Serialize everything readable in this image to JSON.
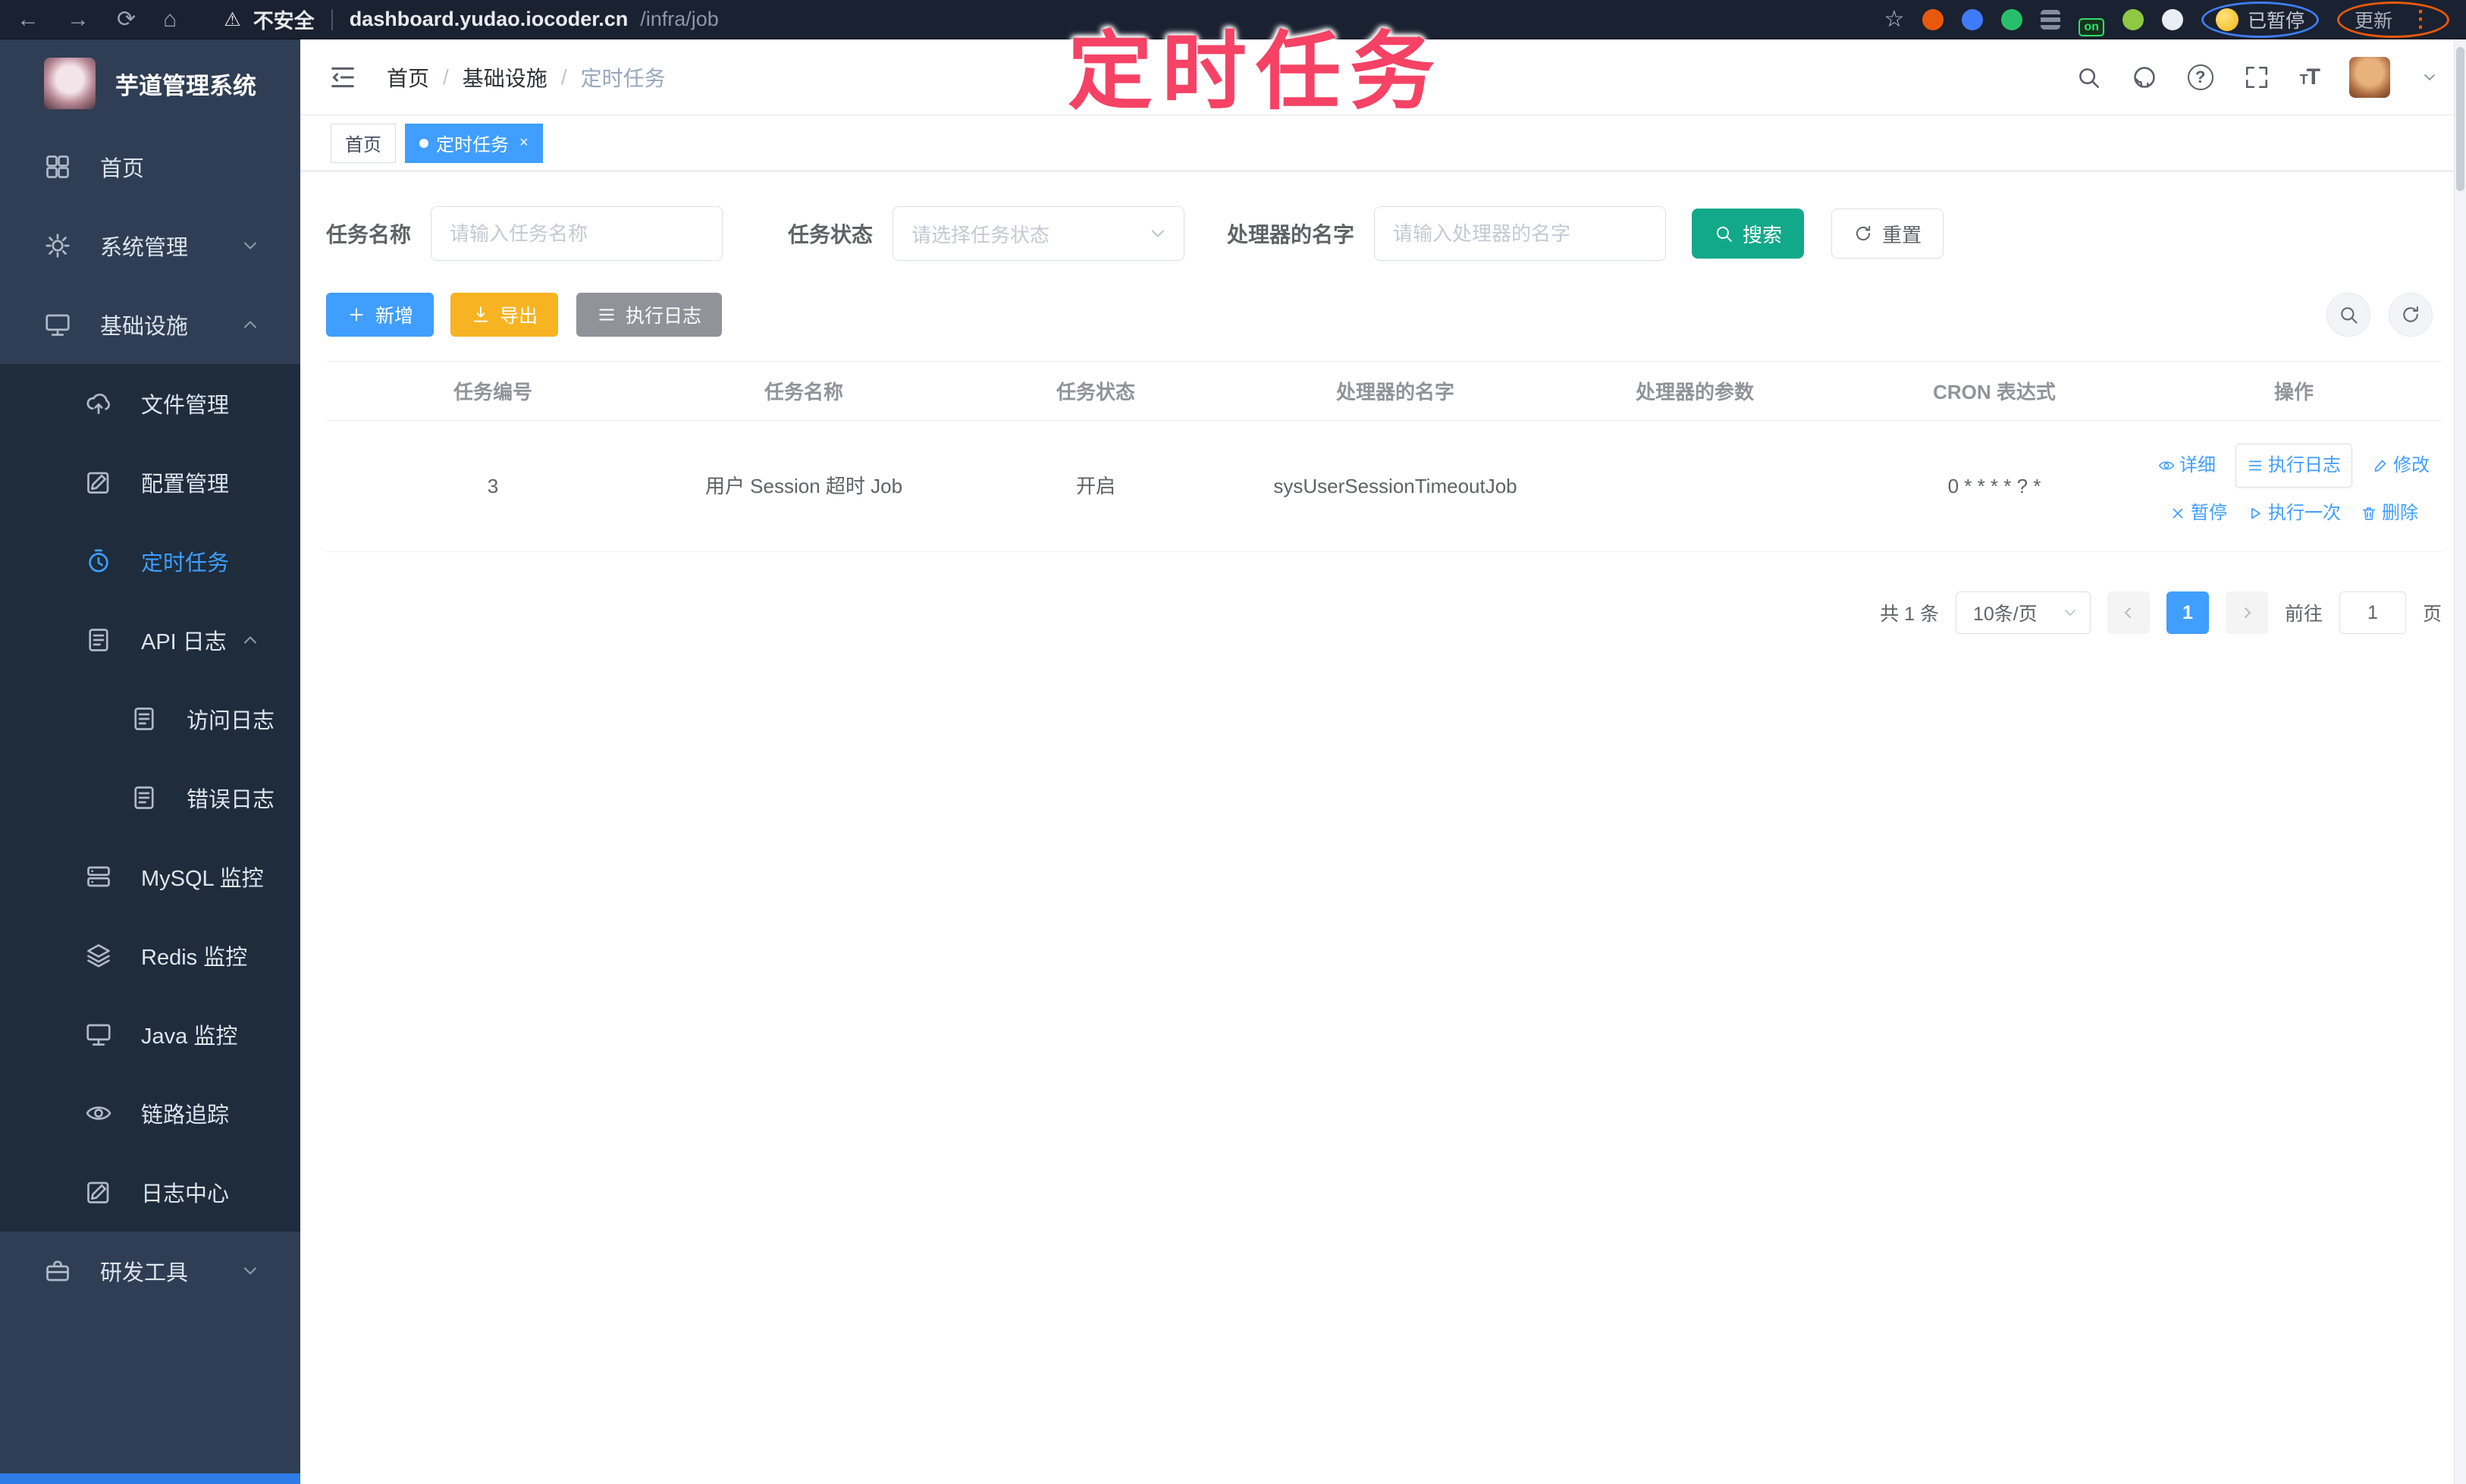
{
  "browser": {
    "back_glyph": "←",
    "forward_glyph": "→",
    "reload_glyph": "⟳",
    "home_glyph": "⌂",
    "warning_glyph": "⚠",
    "security_label": "不安全",
    "url_host": "dashboard.yudao.iocoder.cn",
    "url_path": "/infra/job",
    "star_glyph": "☆",
    "on_badge": "on",
    "paused_label": "已暂停",
    "update_label": "更新",
    "kebab_glyph": "⋮"
  },
  "overlay": {
    "title": "定时任务",
    "color": "#f54265"
  },
  "sidebar": {
    "app_title": "芋道管理系统",
    "items": [
      {
        "label": "首页",
        "level": 1
      },
      {
        "label": "系统管理",
        "level": 1,
        "chevron": "down"
      },
      {
        "label": "基础设施",
        "level": 1,
        "chevron": "up"
      },
      {
        "label": "文件管理",
        "level": 2
      },
      {
        "label": "配置管理",
        "level": 2
      },
      {
        "label": "定时任务",
        "level": 2,
        "active": true
      },
      {
        "label": "API 日志",
        "level": 2,
        "chevron": "up"
      },
      {
        "label": "访问日志",
        "level": 3
      },
      {
        "label": "错误日志",
        "level": 3
      },
      {
        "label": "MySQL 监控",
        "level": 2
      },
      {
        "label": "Redis 监控",
        "level": 2
      },
      {
        "label": "Java 监控",
        "level": 2
      },
      {
        "label": "链路追踪",
        "level": 2
      },
      {
        "label": "日志中心",
        "level": 2
      },
      {
        "label": "研发工具",
        "level": 1,
        "chevron": "down"
      }
    ]
  },
  "navbar": {
    "breadcrumb": [
      "首页",
      "基础设施",
      "定时任务"
    ],
    "separator": "/",
    "help_glyph": "?",
    "fontsize_glyph": "T"
  },
  "tags": {
    "home": "首页",
    "active": "定时任务",
    "close_glyph": "×"
  },
  "filters": {
    "name_label": "任务名称",
    "name_placeholder": "请输入任务名称",
    "status_label": "任务状态",
    "status_placeholder": "请选择任务状态",
    "handler_label": "处理器的名字",
    "handler_placeholder": "请输入处理器的名字",
    "search_label": "搜索",
    "reset_label": "重置"
  },
  "toolbar": {
    "add_label": "新增",
    "export_label": "导出",
    "log_label": "执行日志"
  },
  "table": {
    "columns": [
      "任务编号",
      "任务名称",
      "任务状态",
      "处理器的名字",
      "处理器的参数",
      "CRON 表达式",
      "操作"
    ],
    "row": {
      "id": "3",
      "name": "用户 Session 超时 Job",
      "status": "开启",
      "handler": "sysUserSessionTimeoutJob",
      "params": "",
      "cron": "0 * * * * ? *"
    },
    "actions": {
      "detail": "详细",
      "log": "执行日志",
      "edit": "修改",
      "pause": "暂停",
      "run_once": "执行一次",
      "delete": "删除"
    }
  },
  "pagination": {
    "total": "共 1 条",
    "page_size": "10条/页",
    "current_page": "1",
    "goto_label": "前往",
    "goto_value": "1",
    "unit_label": "页"
  },
  "colors": {
    "primary": "#409EFF",
    "search_button": "#12a98a",
    "export_button": "#f7b322",
    "annotation": "#f54265"
  }
}
